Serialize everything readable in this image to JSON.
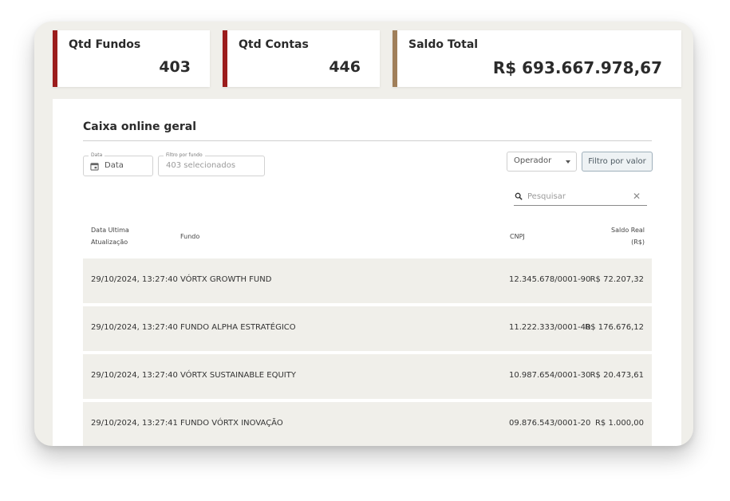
{
  "cards": [
    {
      "title": "Qtd Fundos",
      "value": "403"
    },
    {
      "title": "Qtd Contas",
      "value": "446"
    },
    {
      "title": "Saldo Total",
      "value": "R$ 693.667.978,67"
    }
  ],
  "panel": {
    "title": "Caixa online geral",
    "filters": {
      "date": {
        "label": "Data",
        "value": "Data"
      },
      "fundo": {
        "label": "Filtro por fundo",
        "placeholder": "403 selecionados"
      },
      "operador": {
        "value": "Operador"
      },
      "valor_button": "Filtro por valor"
    },
    "search": {
      "placeholder": "Pesquisar",
      "clear_icon": "close-icon"
    },
    "table": {
      "headers": {
        "date": [
          "Data Ultima",
          "Atualização"
        ],
        "fundo": "Fundo",
        "cnpj": "CNPJ",
        "saldo": [
          "Saldo Real",
          "(R$)"
        ]
      },
      "rows": [
        {
          "date": "29/10/2024, 13:27:40",
          "fundo": "VÓRTX GROWTH FUND",
          "cnpj": "12.345.678/0001-90",
          "saldo": "R$ 72.207,32"
        },
        {
          "date": "29/10/2024, 13:27:40",
          "fundo": "FUNDO ALPHA ESTRATÉGICO",
          "cnpj": "11.222.333/0001-40",
          "saldo": "R$ 176.676,12"
        },
        {
          "date": "29/10/2024, 13:27:40",
          "fundo": "VÓRTX SUSTAINABLE EQUITY",
          "cnpj": "10.987.654/0001-30",
          "saldo": "R$ 20.473,61"
        },
        {
          "date": "29/10/2024, 13:27:41",
          "fundo": "FUNDO VÓRTX INOVAÇÃO",
          "cnpj": "09.876.543/0001-20",
          "saldo": "R$ 1.000,00"
        }
      ]
    }
  },
  "colors": {
    "accent_red": "#9b1c1c",
    "accent_gold": "#a07f5a",
    "row_bg": "#f0efea"
  }
}
